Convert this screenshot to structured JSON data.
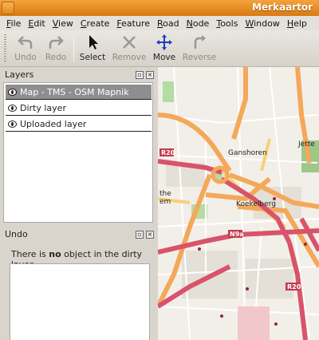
{
  "window": {
    "title": "Merkaartor"
  },
  "menu": [
    "File",
    "Edit",
    "View",
    "Create",
    "Feature",
    "Road",
    "Node",
    "Tools",
    "Window",
    "Help"
  ],
  "toolbar": {
    "undo": "Undo",
    "redo": "Redo",
    "select": "Select",
    "remove": "Remove",
    "move": "Move",
    "reverse": "Reverse"
  },
  "layers_panel": {
    "title": "Layers",
    "items": [
      "Map - TMS - OSM Mapnik",
      "Dirty layer",
      "Uploaded layer"
    ]
  },
  "undo_panel": {
    "title": "Undo",
    "message_pre": "There is ",
    "message_bold": "no",
    "message_post": " object in the dirty layer"
  },
  "map": {
    "labels": [
      "Ganshoren",
      "Jette",
      "Koekelberg",
      "R20",
      "N9a",
      "R20",
      "the",
      "em"
    ],
    "colors": {
      "background": "#f2efe9",
      "motorway": "#d9536a",
      "primary": "#f4a85a",
      "secondary": "#f7d07a",
      "park": "#b5dca2",
      "forest": "#9cc88a"
    }
  }
}
